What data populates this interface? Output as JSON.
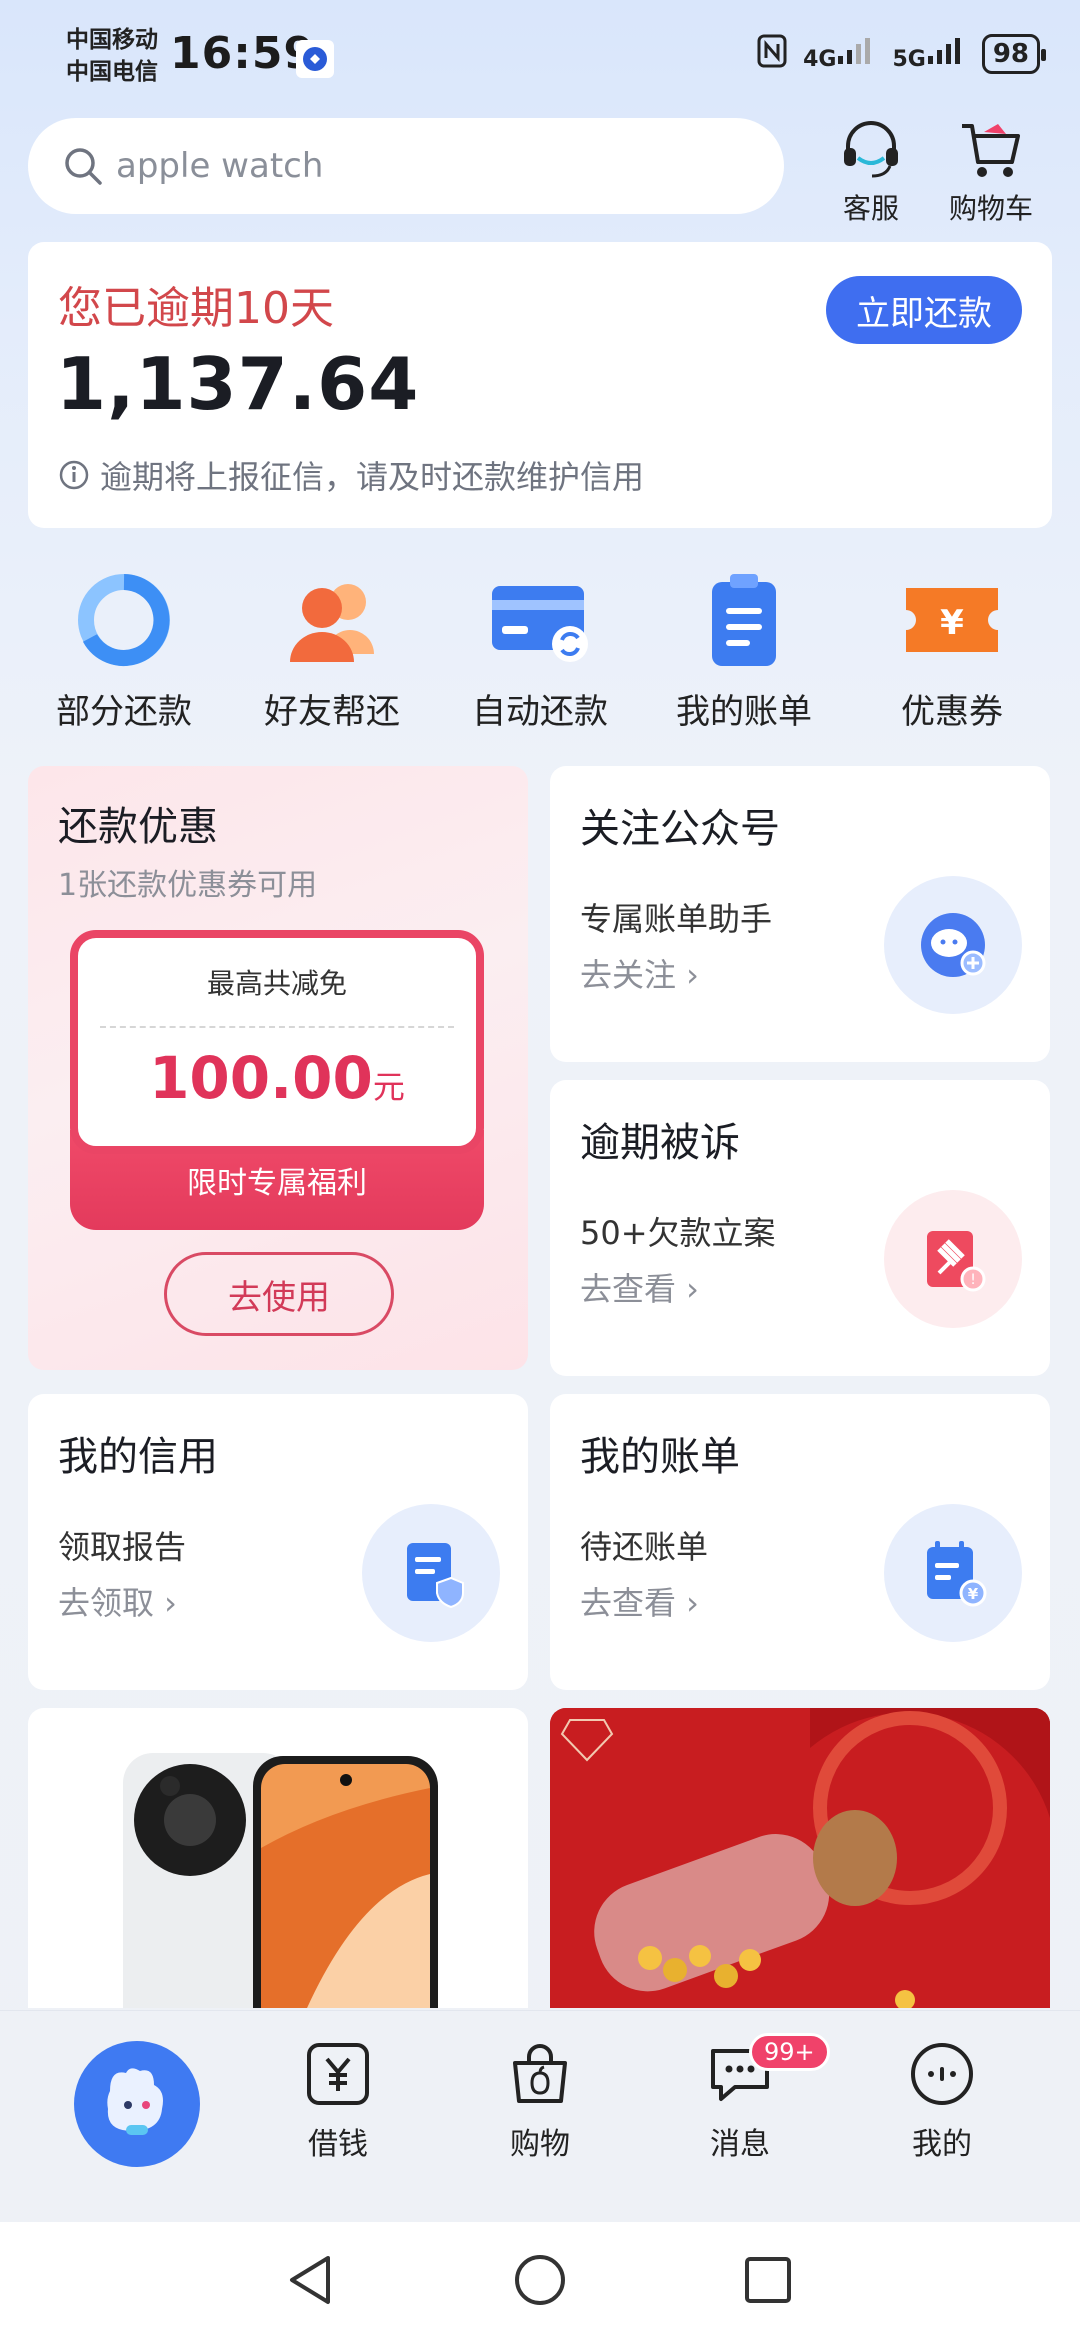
{
  "status_bar": {
    "carrier_1": "中国移动",
    "carrier_2": "中国电信",
    "time": "16:59",
    "network_1": "4G",
    "network_2": "5G",
    "battery": "98"
  },
  "header": {
    "search_placeholder": "apple watch",
    "service_label": "客服",
    "cart_label": "购物车"
  },
  "overdue_card": {
    "title": "您已逾期10天",
    "amount": "1,137.64",
    "note": "逾期将上报征信，请及时还款维护信用",
    "repay_button": "立即还款"
  },
  "quick_actions": [
    {
      "label": "部分还款",
      "icon": "donut-chart-icon"
    },
    {
      "label": "好友帮还",
      "icon": "friends-icon"
    },
    {
      "label": "自动还款",
      "icon": "card-autopay-icon"
    },
    {
      "label": "我的账单",
      "icon": "bill-clipboard-icon"
    },
    {
      "label": "优惠券",
      "icon": "coupon-yen-icon"
    }
  ],
  "promo": {
    "title": "还款优惠",
    "subtitle": "1张还款优惠券可用",
    "coupon_label": "最高共减免",
    "coupon_amount": "100.00",
    "coupon_unit": "元",
    "coupon_footer": "限时专属福利",
    "use_button": "去使用"
  },
  "tiles": [
    {
      "title": "关注公众号",
      "sub": "专属账单助手",
      "link": "去关注 ›",
      "icon": "wechat-icon"
    },
    {
      "title": "逾期被诉",
      "sub": "50+欠款立案",
      "link": "去查看 ›",
      "icon": "gavel-icon"
    },
    {
      "title": "我的信用",
      "sub": "领取报告",
      "link": "去领取 ›",
      "icon": "credit-report-icon"
    },
    {
      "title": "我的账单",
      "sub": "待还账单",
      "link": "去查看 ›",
      "icon": "bill-yen-icon"
    }
  ],
  "bottom_nav": [
    {
      "label": "",
      "icon": "mascot-icon"
    },
    {
      "label": "借钱",
      "icon": "yen-box-icon"
    },
    {
      "label": "购物",
      "icon": "shopping-bag-icon"
    },
    {
      "label": "消息",
      "icon": "chat-icon",
      "badge": "99+"
    },
    {
      "label": "我的",
      "icon": "profile-dots-icon"
    }
  ],
  "colors": {
    "accent": "#3f6ef0",
    "overdue_red": "#d2474b",
    "coupon_red": "#ea4565"
  }
}
